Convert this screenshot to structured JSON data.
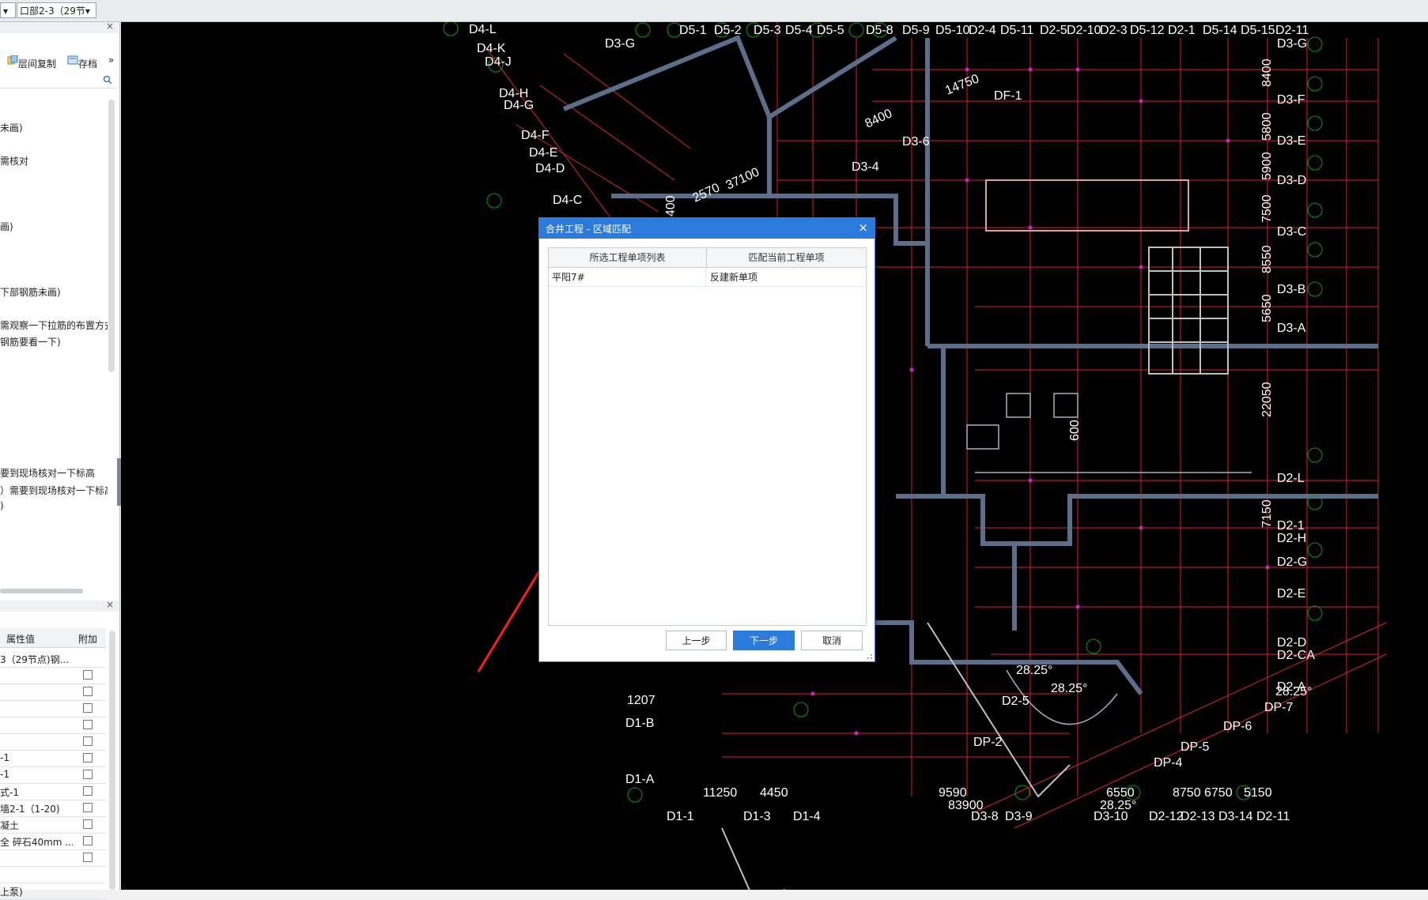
{
  "toolbar": {
    "combo_left": "▾",
    "combo_floor": "口部2-3（29节",
    "combo_arrow": "▾"
  },
  "sidebar": {
    "close_glyph": "×",
    "tools": {
      "floor_copy": "层间复制",
      "save": "存档",
      "more": "»"
    },
    "search_icon": "search-icon",
    "notes": [
      "未画)",
      "需核对",
      "画)",
      "下部钢筋未画)",
      "需观察一下拉筋的布置方式",
      "钢筋要看一下)",
      "要到现场核对一下标高",
      "）需要到现场核对一下标高",
      ")"
    ],
    "properties": {
      "col_value": "属性值",
      "col_attach": "附加",
      "rows": [
        "3（29节点)钢...",
        "",
        "",
        "",
        "",
        "",
        "-1",
        "-1",
        "式-1",
        "墙2-1（1-20)",
        "凝土",
        "全 碎石40mm ...",
        "",
        "",
        "上泵)"
      ]
    }
  },
  "cad": {
    "labels_top": [
      "D4-L",
      "D4-K",
      "D4-J",
      "D3-G",
      "D5-1",
      "D5-2",
      "D5-3",
      "D5-4",
      "D5-5",
      "D5-8",
      "D5-9",
      "D5-10",
      "D2-4",
      "D5-11",
      "D2-5",
      "D2-10",
      "D2-3",
      "D5-12",
      "D2-1",
      "D5-14",
      "D5-15",
      "D2-11"
    ],
    "labels_left": [
      "D4-H",
      "D4-G",
      "D4-F",
      "D4-E",
      "D4-D",
      "D4-C"
    ],
    "labels_right": [
      "D3-G",
      "D3-F",
      "D3-E",
      "D3-D",
      "D3-C",
      "D3-B",
      "D3-A",
      "D2-L",
      "D2-1",
      "D2-H",
      "D2-G",
      "D2-E",
      "D2-D",
      "D2-CA",
      "D2-A",
      "DP-7",
      "DP-6",
      "DP-5",
      "DP-4"
    ],
    "labels_bottom": [
      "D1-1",
      "D1-3",
      "D1-4",
      "D3-8",
      "D3-9",
      "D3-10",
      "D2-12",
      "D2-13",
      "D3-14",
      "D2-11"
    ],
    "labels_misc": [
      "DF-1",
      "D3-6",
      "D3-4",
      "D1-B",
      "D1-A",
      "D2-5",
      "DP-2"
    ],
    "dims_vertical_right": [
      "8400",
      "5800",
      "5900",
      "7500",
      "8550",
      "5650",
      "22050",
      "7150"
    ],
    "dims_bottom": [
      "11250",
      "4450",
      "9590",
      "6550",
      "8750",
      "6750",
      "5150",
      "83900"
    ],
    "dims_misc": [
      "14750",
      "8400",
      "2570",
      "37100",
      "1207",
      "8400",
      "600"
    ],
    "angles": [
      "28.25°",
      "28.25°",
      "28.25°",
      "28.25°"
    ]
  },
  "dialog": {
    "title": "合井工程 - 区域匹配",
    "close": "×",
    "col_source": "所选工程单项列表",
    "col_match": "匹配当前工程单项",
    "rows": [
      {
        "source": "平阳7#",
        "match": "反建新单项"
      }
    ],
    "btn_prev": "上一步",
    "btn_next": "下一步",
    "btn_cancel": "取消"
  },
  "colors": {
    "accent": "#2b7bdc",
    "annotation_arrow": "#ff1e1e",
    "cad_bg": "#000000",
    "grid_red": "#e0202a",
    "wall_blue": "#5b6e8a",
    "axis_text": "#ffffff",
    "bubble_green": "#00a000"
  }
}
